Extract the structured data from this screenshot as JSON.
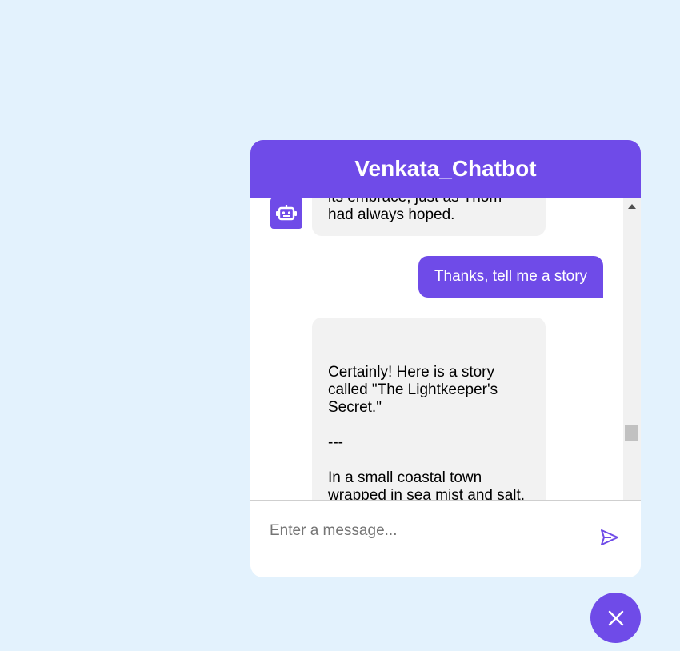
{
  "header": {
    "title": "Venkata_Chatbot"
  },
  "messages": [
    {
      "role": "bot",
      "text": "its embrace, just as Thom\nhad always hoped."
    },
    {
      "role": "user",
      "text": "Thanks, tell me a story"
    },
    {
      "role": "bot",
      "text": "Certainly! Here is a story\ncalled \"The Lightkeeper's\nSecret.\"\n\n---\n\nIn a small coastal town\nwrapped in sea mist and salt,\nstood an ancient lighthouse,\nits beacon a steady pulse"
    }
  ],
  "input": {
    "placeholder": "Enter a message...",
    "value": ""
  },
  "icons": {
    "avatar": "robot-icon",
    "send": "send-icon",
    "close": "close-icon"
  },
  "colors": {
    "accent": "#6f4be8",
    "background": "#e3f2fd",
    "bot_bubble": "#f2f2f2"
  }
}
